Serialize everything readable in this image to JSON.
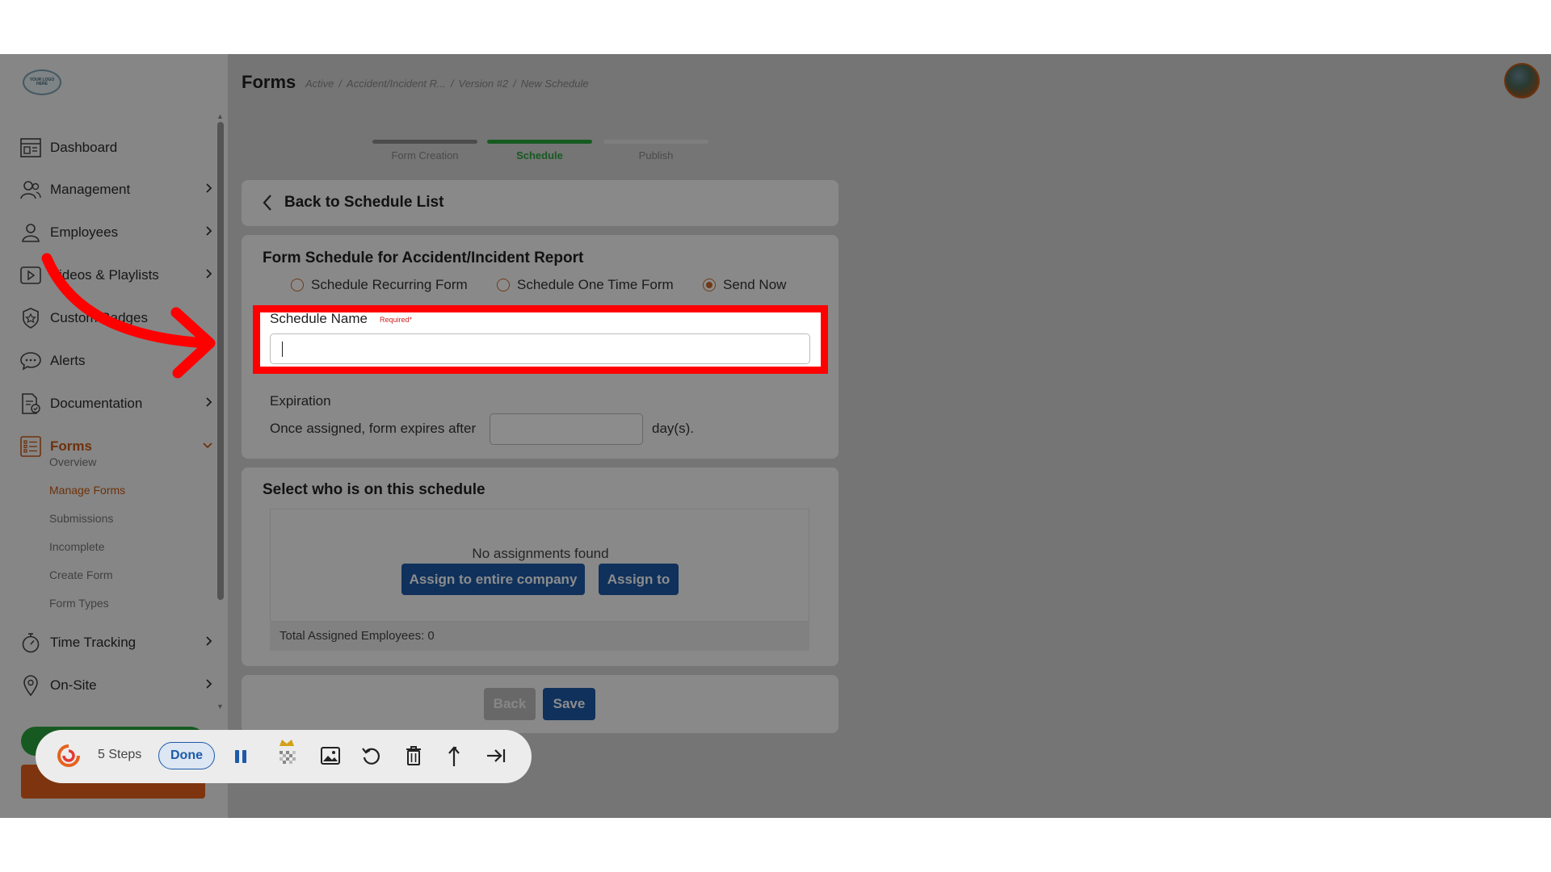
{
  "app": {
    "logo_text": "YOUR LOGO HERE",
    "header_title": "Forms",
    "breadcrumb": [
      "Active",
      "/",
      "Accident/Incident R...",
      "/",
      "Version #2",
      "/",
      "New Schedule"
    ]
  },
  "sidebar": {
    "items": [
      {
        "label": "Dashboard"
      },
      {
        "label": "Management"
      },
      {
        "label": "Employees"
      },
      {
        "label": "Videos & Playlists"
      },
      {
        "label": "Custom Badges"
      },
      {
        "label": "Alerts"
      },
      {
        "label": "Documentation"
      },
      {
        "label": "Forms"
      },
      {
        "label": "Time Tracking"
      },
      {
        "label": "On-Site"
      }
    ],
    "forms_sub": [
      "Overview",
      "Manage Forms",
      "Submissions",
      "Incomplete",
      "Create Form",
      "Form Types"
    ]
  },
  "steps": [
    {
      "label": "Form Creation",
      "color": "#8a8a8a"
    },
    {
      "label": "Schedule",
      "color": "#2aa53d"
    },
    {
      "label": "Publish",
      "color": "#e6e6e6"
    }
  ],
  "back_link": "Back to Schedule List",
  "form": {
    "title": "Form Schedule for Accident/Incident Report",
    "options": [
      "Schedule Recurring Form",
      "Schedule One Time Form",
      "Send Now"
    ],
    "selected": "Send Now",
    "name_label": "Schedule Name",
    "required": "Required*",
    "name_value": "",
    "expiration_label": "Expiration",
    "expiration_text": "Once assigned, form expires after",
    "expiration_value": "",
    "expiration_unit": "day(s)."
  },
  "schedule": {
    "title": "Select who is on this schedule",
    "empty": "No assignments found",
    "assign_company": "Assign to entire company",
    "assign_to": "Assign to",
    "total": "Total Assigned Employees: 0"
  },
  "footer": {
    "back": "Back",
    "save": "Save"
  },
  "toolbar": {
    "steps": "5 Steps",
    "done": "Done"
  },
  "colors": {
    "accent": "#c85a15",
    "primary": "#1d5aa8",
    "success": "#2aa53d",
    "highlight": "#ff0000"
  }
}
